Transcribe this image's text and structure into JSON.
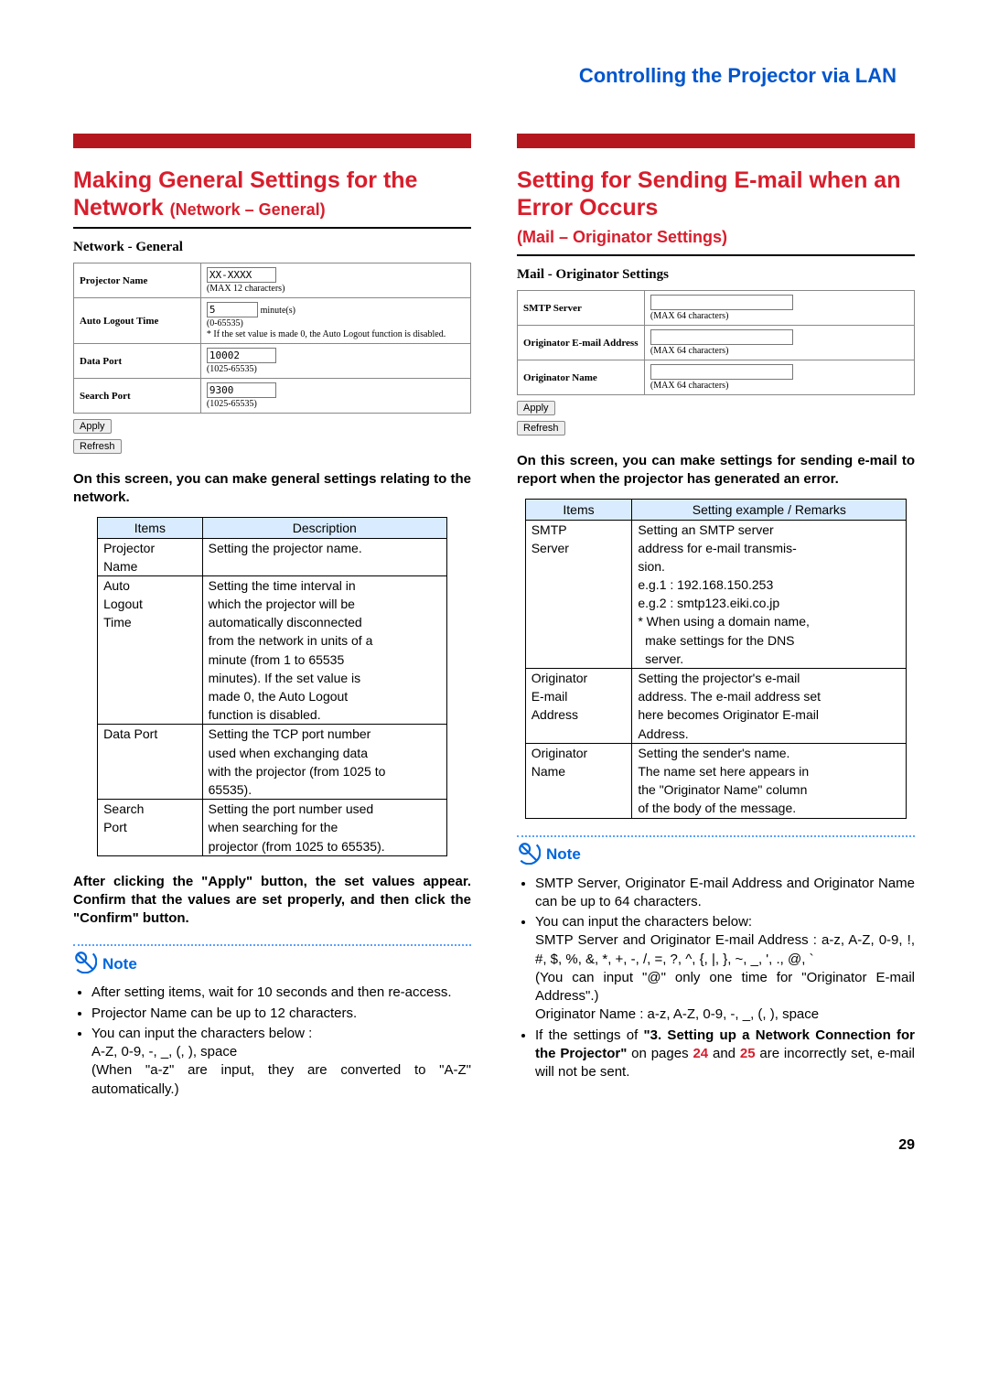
{
  "page_header": "Controlling the Projector via LAN",
  "page_number": "29",
  "left": {
    "title_main": "Making General Settings for the Network ",
    "title_sub": "(Network – General)",
    "form_title": "Network - General",
    "form": {
      "projector_name_label": "Projector Name",
      "projector_name_value": "XX-XXXX",
      "projector_name_hint": "(MAX 12 characters)",
      "auto_logout_label": "Auto Logout Time",
      "auto_logout_value": "5",
      "auto_logout_unit": "minute(s)",
      "auto_logout_range": "(0-65535)",
      "auto_logout_note": "* If the set value is made 0, the Auto Logout function is disabled.",
      "data_port_label": "Data Port",
      "data_port_value": "10002",
      "data_port_range": "(1025-65535)",
      "search_port_label": "Search Port",
      "search_port_value": "9300",
      "search_port_range": "(1025-65535)"
    },
    "apply_btn": "Apply",
    "refresh_btn": "Refresh",
    "intro_bold": "On this screen, you can make general settings relating to the network.",
    "table_headers": {
      "items": "Items",
      "desc": "Description"
    },
    "table_rows": [
      {
        "item": "Projector Name",
        "desc": "Setting the projector name."
      },
      {
        "item": "Auto Logout Time",
        "desc": "Setting the time interval in which the projector will be automatically disconnected from the network in units of a minute (from 1 to 65535 minutes). If the set value is made 0, the Auto Logout function is disabled."
      },
      {
        "item": "Data Port",
        "desc": "Setting the TCP port number used when exchanging data with the projector (from 1025 to 65535)."
      },
      {
        "item": "Search Port",
        "desc": "Setting the port number used when searching for the projector (from 1025 to 65535)."
      }
    ],
    "after_apply_bold": "After clicking the \"Apply\" button, the set values appear. Confirm that the values are set properly, and then click the \"Confirm\" button.",
    "note_label": "Note",
    "notes": [
      "After setting items, wait for 10 seconds and then re-access.",
      "Projector Name can be up to 12 characters.",
      "You can input the characters below :\nA-Z, 0-9, -, _, (, ), space\n(When \"a-z\" are input, they are converted to \"A-Z\" automatically.)"
    ]
  },
  "right": {
    "title_main": "Setting for Sending E-mail when an Error Occurs",
    "title_sub": "(Mail – Originator Settings)",
    "form_title": "Mail - Originator Settings",
    "form": {
      "smtp_label": "SMTP Server",
      "smtp_hint": "(MAX 64 characters)",
      "orig_email_label": "Originator E-mail Address",
      "orig_email_hint": "(MAX 64 characters)",
      "orig_name_label": "Originator Name",
      "orig_name_hint": "(MAX 64 characters)"
    },
    "apply_btn": "Apply",
    "refresh_btn": "Refresh",
    "intro_bold": "On this screen, you can make settings for sending e-mail to report when the projector has generated an error.",
    "table_headers": {
      "items": "Items",
      "desc": "Setting example / Remarks"
    },
    "table_rows": [
      {
        "item": "SMTP Server",
        "desc": "Setting an SMTP server address for e-mail transmission.\ne.g.1 : 192.168.150.253\ne.g.2 : smtp123.eiki.co.jp\n* When using a domain name, make settings for the DNS server."
      },
      {
        "item": "Originator E-mail Address",
        "desc": "Setting the projector's e-mail address. The e-mail address set here becomes Originator E-mail Address."
      },
      {
        "item": "Originator Name",
        "desc": "Setting the sender's name. The name set here appears in the \"Originator Name\" column of the body of the message."
      }
    ],
    "note_label": "Note",
    "notes_pre": "SMTP Server, Originator E-mail Address and Originator Name can be up to 64 characters.",
    "notes_chars_intro": "You can input the characters below:",
    "notes_chars_line1": "SMTP Server and Originator E-mail Address : a-z, A-Z, 0-9, !, #, $, %, &, *, +, -, /, =, ?, ^, {, |, }, ~, _, ', ., @, `",
    "notes_chars_paren": "(You can input \"@\" only one time for \"Originator E-mail Address\".)",
    "notes_chars_line2": "Originator Name : a-z, A-Z, 0-9, -, _, (, ), space",
    "notes_net_pre": "If the settings of ",
    "notes_net_bold": "\"3. Setting up a Network Connection for the Projector\"",
    "notes_net_mid": " on pages ",
    "notes_net_p1": "24",
    "notes_net_and": " and ",
    "notes_net_p2": "25",
    "notes_net_post": " are incorrectly set, e-mail will not be sent."
  }
}
